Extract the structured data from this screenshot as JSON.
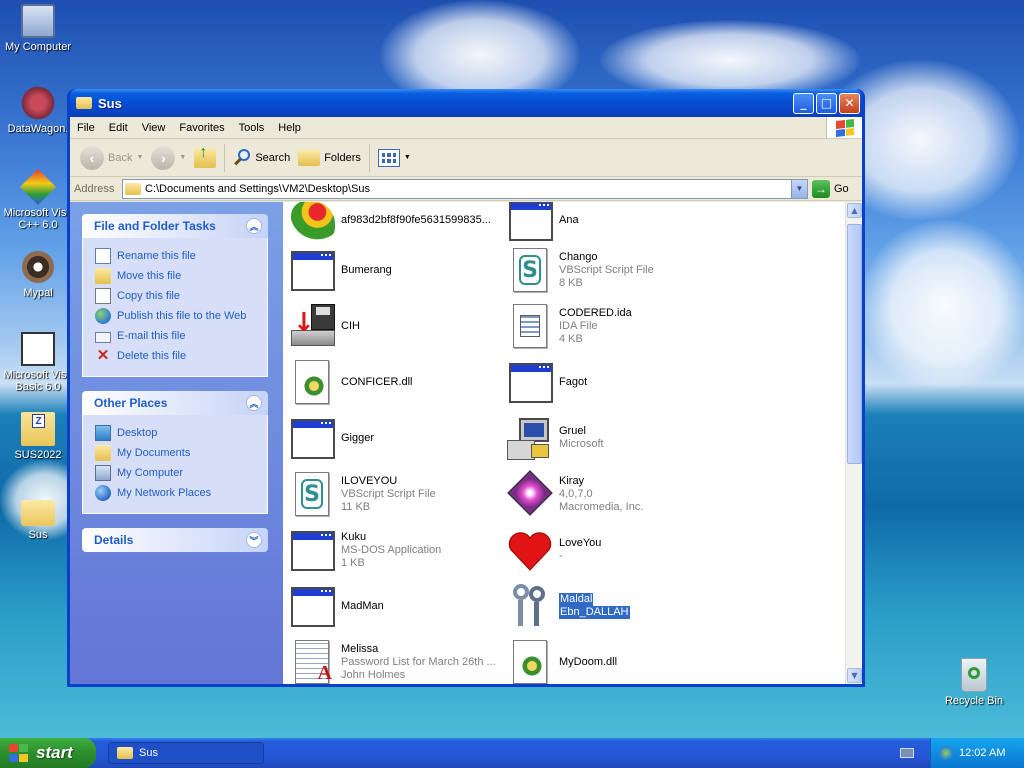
{
  "desktop": {
    "icons": [
      {
        "label": "My Computer",
        "icon": "computer-icon"
      },
      {
        "label": "DataWagon.",
        "icon": "datawagon-icon"
      },
      {
        "label": "Microsoft Visu C++ 6.0",
        "icon": "visual-cpp-icon"
      },
      {
        "label": "Mypal",
        "icon": "mypal-icon"
      },
      {
        "label": "Microsoft Visu Basic 6.0",
        "icon": "visual-basic-icon"
      },
      {
        "label": "SUS2022",
        "icon": "zip-folder-icon"
      },
      {
        "label": "Sus",
        "icon": "folder-icon"
      },
      {
        "label": "Recycle Bin",
        "icon": "recycle-bin-icon"
      }
    ]
  },
  "window": {
    "title": "Sus",
    "menu": [
      "File",
      "Edit",
      "View",
      "Favorites",
      "Tools",
      "Help"
    ],
    "toolbar": {
      "back": "Back",
      "search": "Search",
      "folders": "Folders"
    },
    "address": {
      "label": "Address",
      "value": "C:\\Documents and Settings\\VM2\\Desktop\\Sus",
      "go": "Go"
    }
  },
  "taskpane": {
    "file_tasks": {
      "title": "File and Folder Tasks",
      "items": [
        "Rename this file",
        "Move this file",
        "Copy this file",
        "Publish this file to the Web",
        "E-mail this file",
        "Delete this file"
      ]
    },
    "other_places": {
      "title": "Other Places",
      "items": [
        "Desktop",
        "My Documents",
        "My Computer",
        "My Network Places"
      ]
    },
    "details": {
      "title": "Details"
    }
  },
  "files": [
    {
      "name": "af983d2bf8f90fe5631599835...",
      "line2": "",
      "line3": "",
      "icon": "parrot-icon"
    },
    {
      "name": "Ana",
      "line2": "",
      "line3": "",
      "icon": "application-window-icon"
    },
    {
      "name": "Bumerang",
      "line2": "",
      "line3": "",
      "icon": "application-window-icon"
    },
    {
      "name": "Chango",
      "line2": "VBScript Script File",
      "line3": "8 KB",
      "icon": "vbscript-icon"
    },
    {
      "name": "CIH",
      "line2": "",
      "line3": "",
      "icon": "floppy-install-icon"
    },
    {
      "name": "CODERED.ida",
      "line2": "IDA File",
      "line3": "4 KB",
      "icon": "ida-file-icon"
    },
    {
      "name": "CONFICER.dll",
      "line2": "",
      "line3": "",
      "icon": "dll-icon"
    },
    {
      "name": "Fagot",
      "line2": "",
      "line3": "",
      "icon": "application-window-icon"
    },
    {
      "name": "Gigger",
      "line2": "",
      "line3": "",
      "icon": "application-window-icon"
    },
    {
      "name": "Gruel",
      "line2": "Microsoft",
      "line3": "",
      "icon": "computer-setup-icon"
    },
    {
      "name": "ILOVEYOU",
      "line2": "VBScript Script File",
      "line3": "11 KB",
      "icon": "vbscript-icon"
    },
    {
      "name": "Kiray",
      "line2": "4,0,7,0",
      "line3": "Macromedia, Inc.",
      "icon": "macromedia-icon"
    },
    {
      "name": "Kuku",
      "line2": "MS-DOS Application",
      "line3": "1 KB",
      "icon": "application-window-icon"
    },
    {
      "name": "LoveYou",
      "line2": "-",
      "line3": "",
      "icon": "heart-icon"
    },
    {
      "name": "MadMan",
      "line2": "",
      "line3": "",
      "icon": "application-window-icon"
    },
    {
      "name": "Maldal",
      "line2": "Ebn_DALLAH",
      "line3": "",
      "icon": "keys-icon"
    },
    {
      "name": "Melissa",
      "line2": "Password List for March 26th ...",
      "line3": "John Holmes",
      "icon": "word-document-icon"
    },
    {
      "name": "MyDoom.dll",
      "line2": "",
      "line3": "",
      "icon": "dll-icon"
    }
  ],
  "taskbar": {
    "start": "start",
    "task": "Sus",
    "clock": "12:02 AM"
  },
  "colors": {
    "selection": "#316ac5",
    "link": "#215dc6",
    "titlebar": "#0549d0"
  }
}
